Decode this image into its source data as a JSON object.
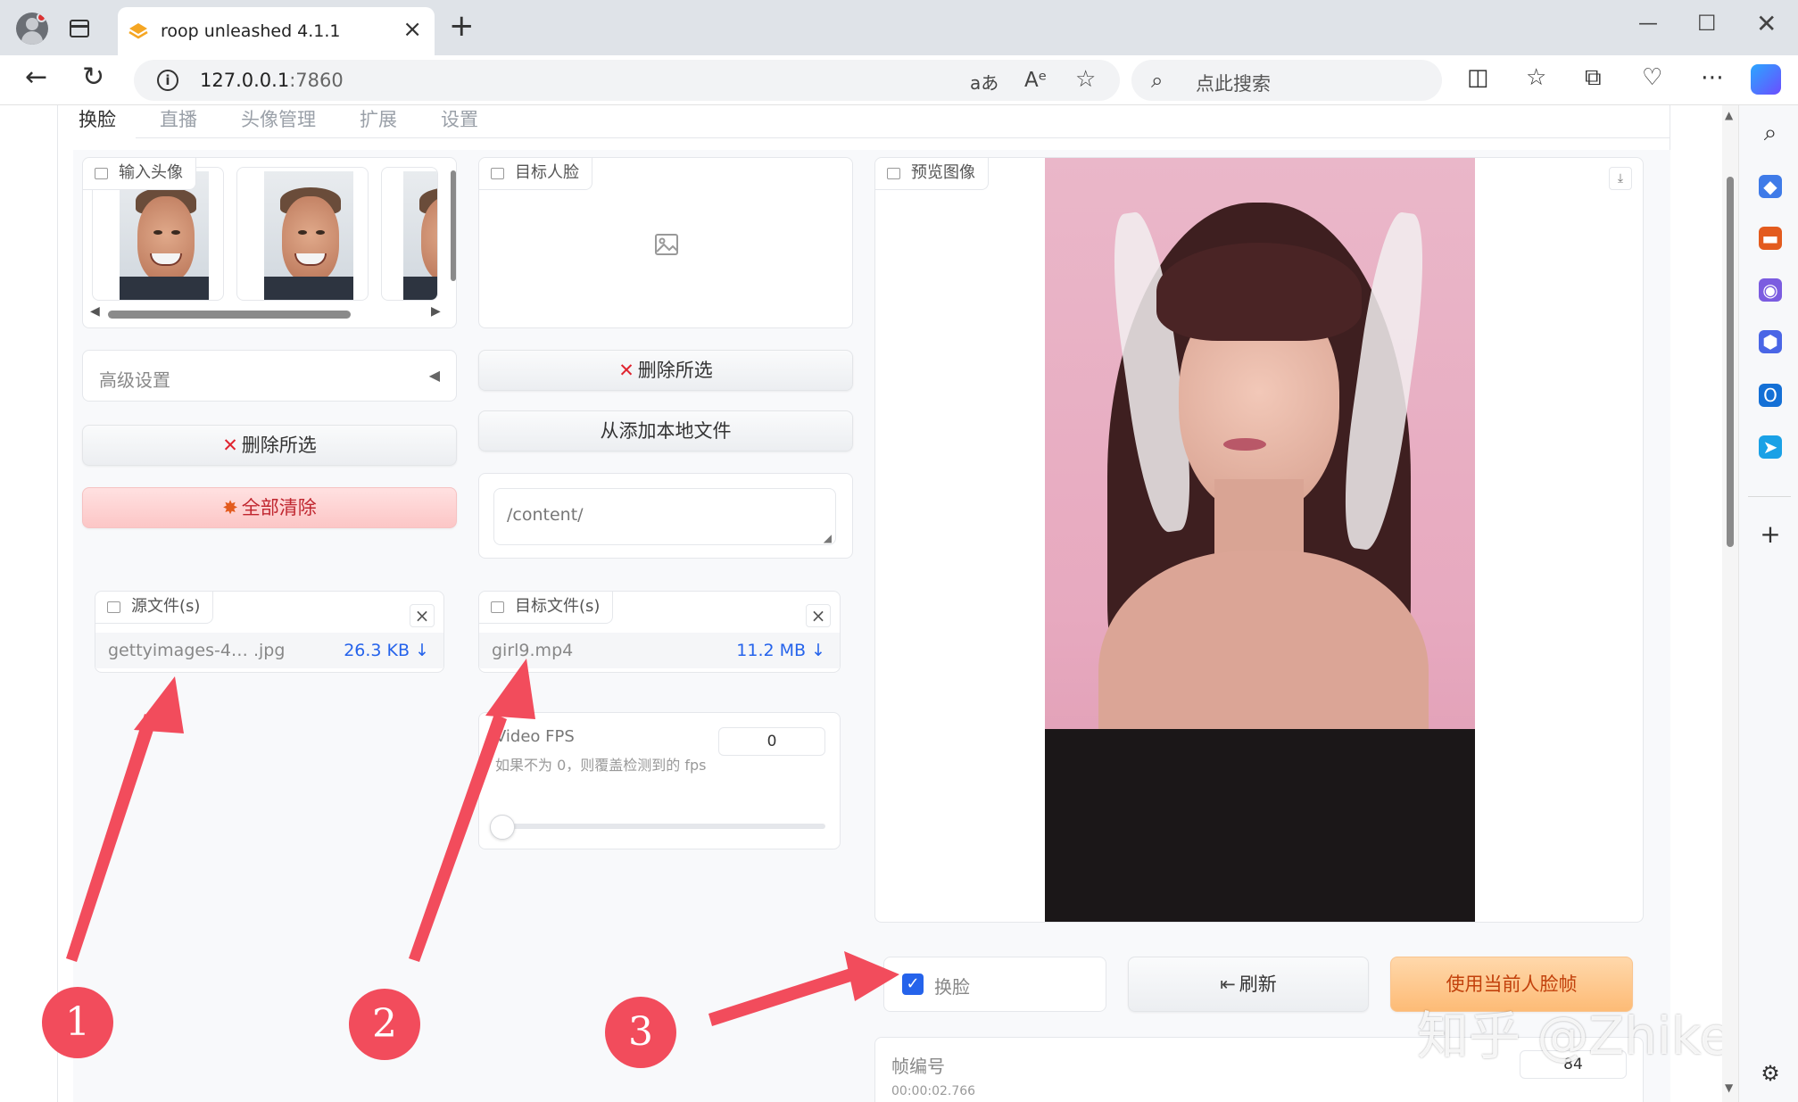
{
  "browser": {
    "tab_title": "roop unleashed 4.1.1",
    "url_host": "127.0.0.1",
    "url_port": ":7860",
    "search_placeholder": "点此搜索",
    "translate_icon_text": "aあ",
    "read_aloud_icon_text": "Aᵉ"
  },
  "app": {
    "tabs": [
      "换脸",
      "直播",
      "头像管理",
      "扩展",
      "设置"
    ],
    "active_tab": "换脸",
    "input_faces": {
      "label": "输入头像"
    },
    "target_face": {
      "label": "目标人脸"
    },
    "preview": {
      "label": "预览图像"
    },
    "advanced_settings": "高级设置",
    "delete_selected_left": "删除所选",
    "clear_all": "全部清除",
    "delete_selected_right": "删除所选",
    "add_local_file": "从添加本地文件",
    "folder_path": "/content/",
    "source_files": {
      "label": "源文件(s)",
      "file_name": "gettyimages-4… .jpg",
      "file_size": "26.3 KB ↓"
    },
    "target_files": {
      "label": "目标文件(s)",
      "file_name": "girl9.mp4",
      "file_size": "11.2 MB ↓"
    },
    "video_fps": {
      "label": "Video FPS",
      "hint": "如果不为 0，则覆盖检测到的 fps",
      "value": "0",
      "slider_level": 0
    },
    "swap_face_checkbox": {
      "label": "换脸",
      "checked": true
    },
    "refresh_button": "刷新",
    "use_current_frame_button": "使用当前人脸帧",
    "frame_number": {
      "label": "帧编号",
      "value": "84",
      "timestamp": "00:00:02.766"
    }
  },
  "annotations": [
    "1",
    "2",
    "3"
  ],
  "watermark": "知乎 @Zhikes",
  "colors": {
    "accent_blue": "#2563eb",
    "annotation_red": "#f24c5c",
    "orange_button": "#fdbb76"
  }
}
